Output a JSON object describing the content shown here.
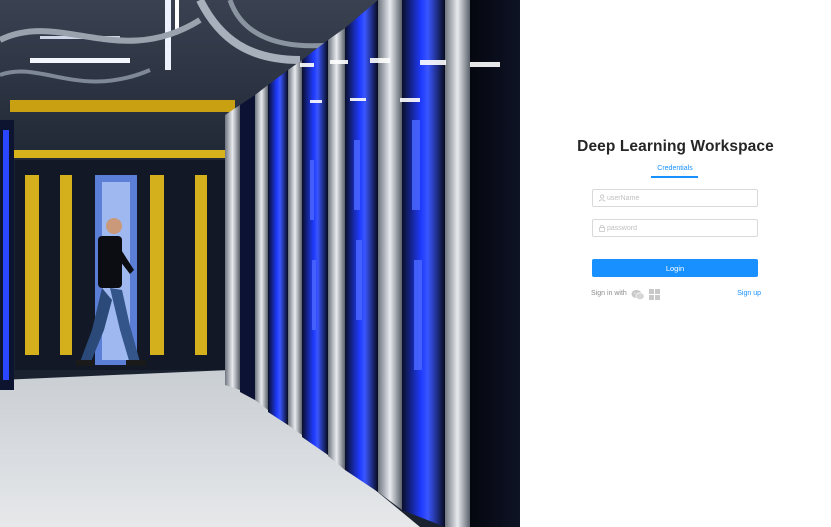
{
  "login": {
    "title": "Deep Learning Workspace",
    "tabs": [
      {
        "label": "Credentials",
        "active": true
      }
    ],
    "username": {
      "placeholder": "userName",
      "value": ""
    },
    "password": {
      "placeholder": "password",
      "value": ""
    },
    "login_button": "Login",
    "sign_in_with_label": "Sign in with",
    "sign_in_providers": [
      {
        "icon": "wechat-icon",
        "color": "#c8c8c8"
      },
      {
        "icon": "windows-icon",
        "color": "#c8c8c8"
      }
    ],
    "sign_up_label": "Sign up"
  },
  "hero": {
    "description_icon": "datacenter-photo",
    "colors": {
      "server_blue": "#1a3cff",
      "cable_yellow": "#e8c41a",
      "floor": "#d9dcdf"
    }
  },
  "colors": {
    "accent": "#1890ff",
    "title": "#262626",
    "muted": "#8c8c8c",
    "border": "#d9d9d9",
    "placeholder": "#bfbfbf"
  }
}
